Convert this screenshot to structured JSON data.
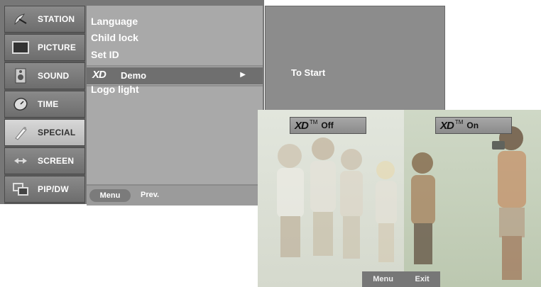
{
  "sidebar": {
    "items": [
      {
        "label": "STATION",
        "icon": "satellite-dish-icon"
      },
      {
        "label": "PICTURE",
        "icon": "picture-screen-icon"
      },
      {
        "label": "SOUND",
        "icon": "speaker-icon"
      },
      {
        "label": "TIME",
        "icon": "clock-icon"
      },
      {
        "label": "SPECIAL",
        "icon": "special-icon"
      },
      {
        "label": "SCREEN",
        "icon": "screen-adjust-icon"
      },
      {
        "label": "PIP/DW",
        "icon": "pip-icon"
      }
    ],
    "active": "SPECIAL"
  },
  "submenu": {
    "items": [
      "Language",
      "Child lock",
      "Set ID",
      "Logo light"
    ],
    "demo": {
      "logo": "XD",
      "label": "Demo",
      "arrow": "▶"
    },
    "bottom": {
      "menu_button": "Menu",
      "prev": "Prev."
    }
  },
  "right_panel": {
    "to_start": "To Start"
  },
  "demo_window": {
    "off_tag": {
      "logo": "XD",
      "tm": "TM",
      "state": "Off"
    },
    "on_tag": {
      "logo": "XD",
      "tm": "TM",
      "state": "On"
    },
    "footer": {
      "menu": "Menu",
      "exit": "Exit"
    }
  }
}
